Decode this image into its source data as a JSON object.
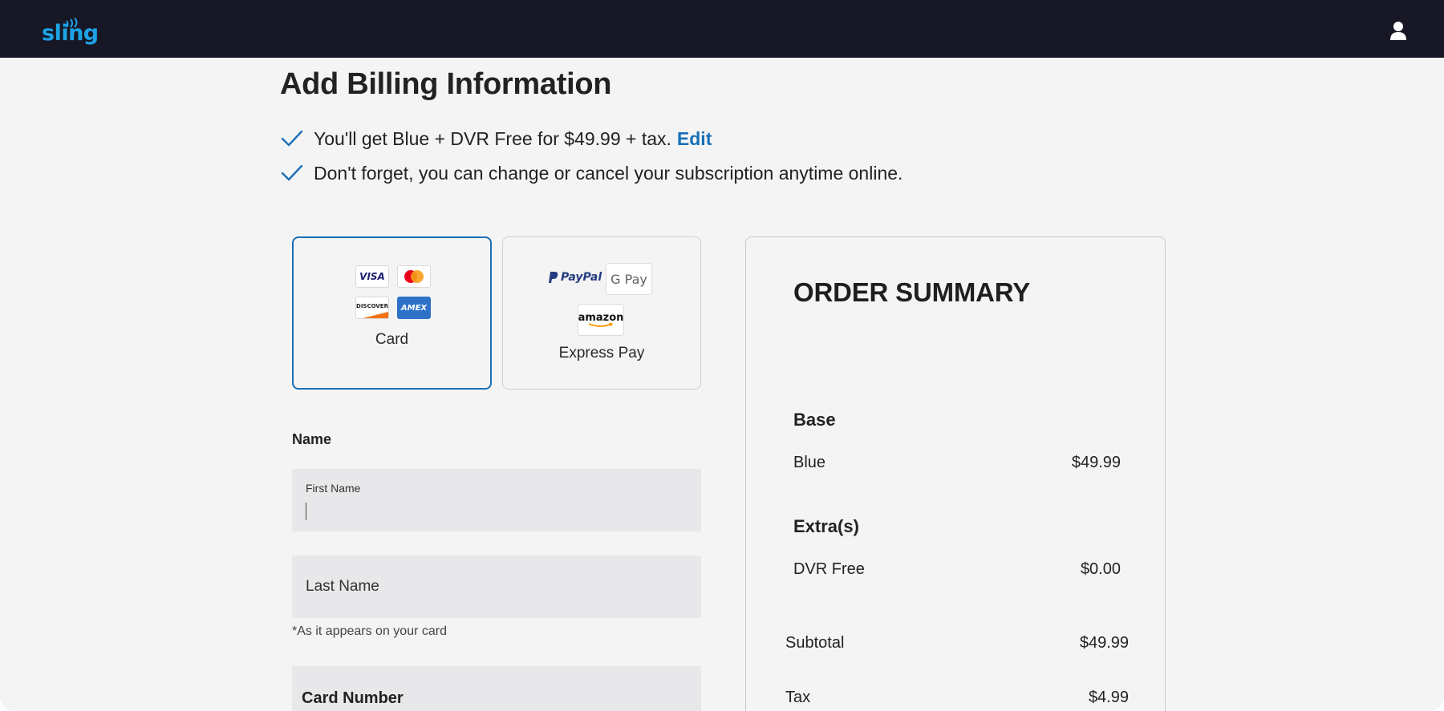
{
  "header": {
    "logo_text": "sling",
    "user_icon": "user-icon"
  },
  "page": {
    "title": "Add Billing Information",
    "notes": [
      {
        "text": "You'll get Blue + DVR Free for $49.99 + tax.",
        "link": "Edit"
      },
      {
        "text": "Don't forget, you can change or cancel your subscription anytime online."
      }
    ]
  },
  "payment_methods": {
    "card": {
      "label": "Card",
      "brands": [
        "VISA",
        "mastercard",
        "DISCOVER",
        "AMEX"
      ],
      "selected": true
    },
    "express": {
      "label": "Express Pay",
      "brands": [
        "PayPal",
        "G Pay",
        "amazon"
      ],
      "selected": false
    }
  },
  "form": {
    "name_section": "Name",
    "first_name": {
      "label": "First Name",
      "value": ""
    },
    "last_name": {
      "placeholder": "Last Name"
    },
    "name_hint": "*As it appears on your card",
    "card_number": {
      "label": "Card Number"
    }
  },
  "summary": {
    "title": "ORDER SUMMARY",
    "base_heading": "Base",
    "base_items": [
      {
        "name": "Blue",
        "price": "$49.99"
      }
    ],
    "extras_heading": "Extra(s)",
    "extra_items": [
      {
        "name": "DVR Free",
        "price": "$0.00"
      }
    ],
    "subtotal_label": "Subtotal",
    "subtotal": "$49.99",
    "tax_label": "Tax",
    "tax": "$4.99"
  },
  "colors": {
    "topbar": "#171726",
    "brand": "#1ca3e6",
    "accent": "#1c6fb6",
    "link": "#1770b8",
    "background": "#f4f4f4",
    "input": "#e8e8ea"
  }
}
